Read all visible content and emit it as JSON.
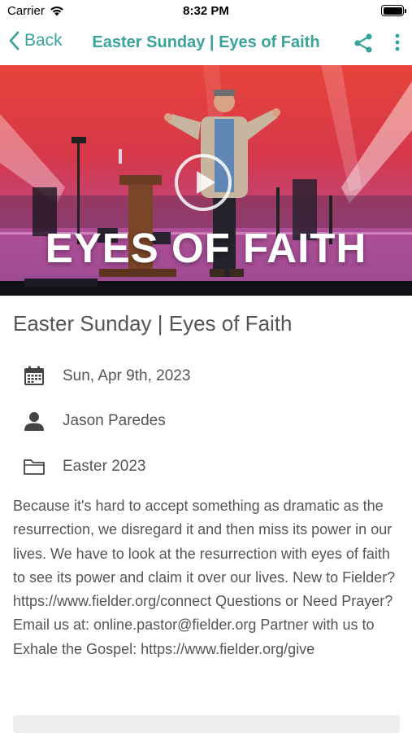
{
  "status_bar": {
    "carrier": "Carrier",
    "time": "8:32 PM",
    "battery_level": 1.0
  },
  "nav": {
    "back_label": "Back",
    "title": "Easter Sunday | Eyes of Faith",
    "accent_color": "#3aa39c",
    "back_icon": "chevron-left-icon",
    "share_icon": "share-icon",
    "more_icon": "more-vertical-icon"
  },
  "hero": {
    "overlay_text": "EYES OF FAITH",
    "play_icon": "play-icon"
  },
  "sermon": {
    "title": "Easter Sunday | Eyes of Faith",
    "date": "Sun, Apr 9th, 2023",
    "speaker": "Jason Paredes",
    "series": "Easter 2023",
    "date_icon": "calendar-icon",
    "speaker_icon": "person-icon",
    "series_icon": "folder-icon",
    "description": "Because it's hard to accept something as dramatic as the resurrection, we disregard it and then miss its power in our lives. We have to look at the resurrection with eyes of faith to see its power and claim it over our lives. New to Fielder? https://www.fielder.org/connect Questions or Need Prayer? Email us at: online.pastor@fielder.org Partner with us to Exhale the Gospel: https://www.fielder.org/give"
  }
}
